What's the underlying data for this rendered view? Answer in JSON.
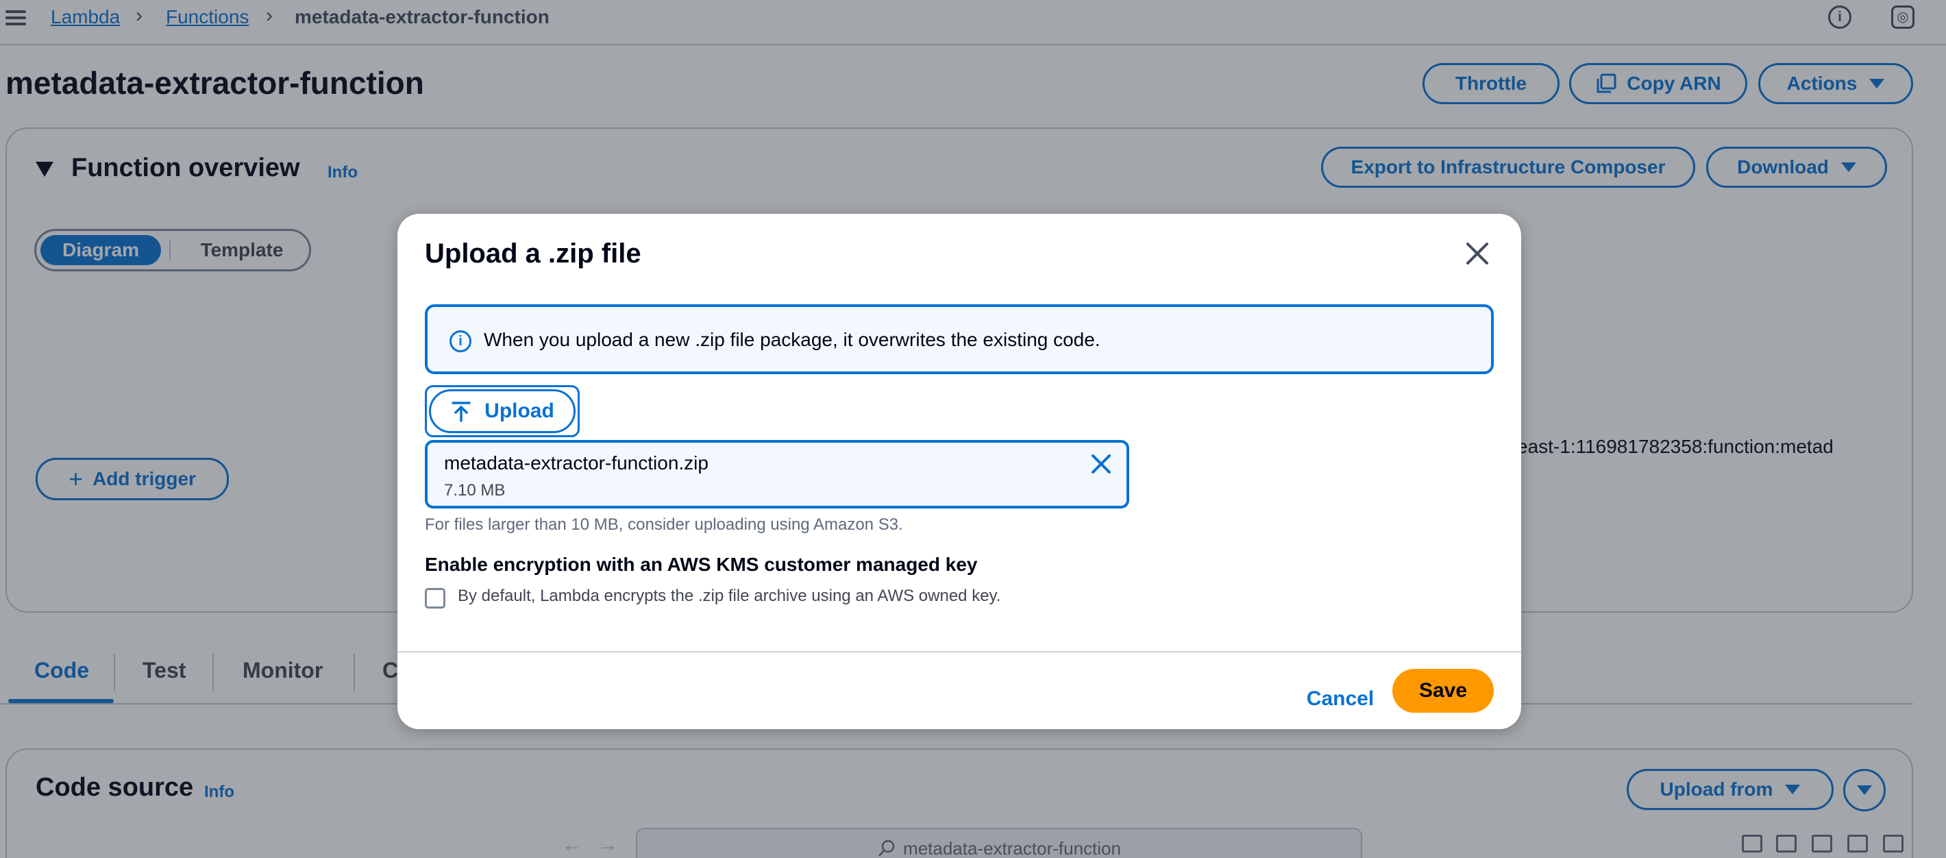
{
  "breadcrumb": {
    "items": [
      "Lambda",
      "Functions"
    ],
    "current": "metadata-extractor-function"
  },
  "page": {
    "title": "metadata-extractor-function",
    "buttons": {
      "throttle": "Throttle",
      "copy_arn": "Copy ARN",
      "actions": "Actions"
    }
  },
  "function_overview": {
    "title": "Function overview",
    "info": "Info",
    "export": "Export to Infrastructure Composer",
    "download": "Download",
    "segments": [
      "Diagram",
      "Template"
    ],
    "add_trigger": "Add trigger",
    "arn_fragment": "east-1:116981782358:function:metad"
  },
  "tabs": [
    "Code",
    "Test",
    "Monitor",
    "C"
  ],
  "code_source": {
    "title": "Code source",
    "info": "Info",
    "upload_from": "Upload from",
    "search_text": "metadata-extractor-function"
  },
  "modal": {
    "title": "Upload a .zip file",
    "alert": "When you upload a new .zip file package, it overwrites the existing code.",
    "upload_label": "Upload",
    "file_name": "metadata-extractor-function.zip",
    "file_size": "7.10 MB",
    "constraint": "For files larger than 10 MB, consider uploading using Amazon S3.",
    "kms_label": "Enable encryption with an AWS KMS customer managed key",
    "kms_description": "By default, Lambda encrypts the .zip file archive using an AWS owned key.",
    "kms_checked": false,
    "cancel": "Cancel",
    "save": "Save"
  },
  "colors": {
    "accent": "#0972d3",
    "primary_button": "#ff9900",
    "text": "#000716"
  }
}
